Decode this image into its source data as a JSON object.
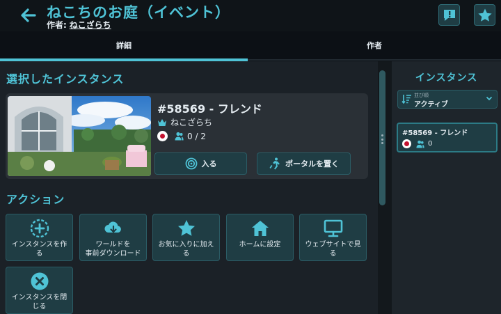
{
  "header": {
    "title": "ねこちのお庭（イベント）",
    "author_label": "作者:",
    "author_name": "ねこざらち"
  },
  "tabs": [
    {
      "label": "詳細",
      "active": true
    },
    {
      "label": "作者",
      "active": false
    }
  ],
  "selected_section": {
    "title": "選択したインスタンス",
    "instance": {
      "name": "#58569 - フレンド",
      "owner": "ねこざらち",
      "region": "JP",
      "players": "0 / 2"
    },
    "buttons": {
      "join": "入る",
      "portal": "ポータルを置く"
    }
  },
  "actions_section": {
    "title": "アクション",
    "items": [
      {
        "label": "インスタンスを作\nる",
        "icon": "plus-circle-icon"
      },
      {
        "label": "ワールドを\n事前ダウンロード",
        "icon": "cloud-download-icon"
      },
      {
        "label": "お気に入りに加え\nる",
        "icon": "star-icon"
      },
      {
        "label": "ホームに設定",
        "icon": "home-icon"
      },
      {
        "label": "ウェブサイトで見\nる",
        "icon": "monitor-icon"
      },
      {
        "label": "インスタンスを閉\nじる",
        "icon": "close-circle-icon"
      }
    ]
  },
  "side_panel": {
    "title": "インスタンス",
    "sort_label": "並び順",
    "sort_value": "アクティブ",
    "items": [
      {
        "name": "#58569 - フレンド",
        "players": "0",
        "region": "JP"
      }
    ]
  },
  "colors": {
    "accent": "#4fc3d6",
    "button_bg": "#1f3d44",
    "background": "#181d22"
  }
}
